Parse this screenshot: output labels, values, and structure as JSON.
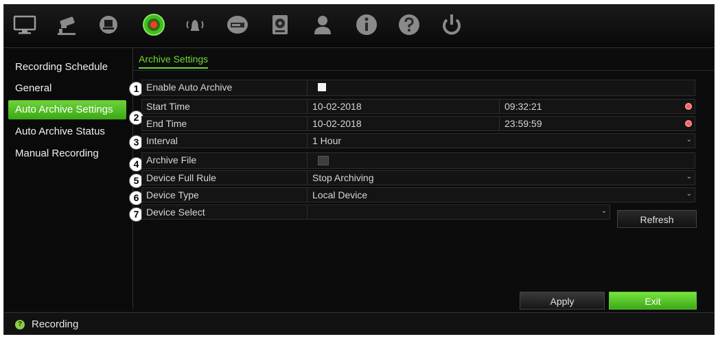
{
  "toolbar": {
    "icons": [
      "monitor-icon",
      "camera-icon",
      "network-icon",
      "record-icon",
      "alarm-icon",
      "hdd-icon",
      "storage-icon",
      "user-icon",
      "info-icon",
      "help-icon",
      "power-icon"
    ],
    "active_icon": "record-icon"
  },
  "sidebar": {
    "items": [
      {
        "label": "Recording Schedule"
      },
      {
        "label": "General"
      },
      {
        "label": "Auto Archive Settings"
      },
      {
        "label": "Auto Archive Status"
      },
      {
        "label": "Manual Recording"
      }
    ],
    "active_index": 2
  },
  "tab": {
    "label": "Archive Settings"
  },
  "form": {
    "enable_auto_archive": {
      "badge": "1",
      "label": "Enable Auto Archive",
      "checked": true
    },
    "time_badge": "2",
    "start_time": {
      "label": "Start Time",
      "date": "10-02-2018",
      "time": "09:32:21"
    },
    "end_time": {
      "label": "End Time",
      "date": "10-02-2018",
      "time": "23:59:59"
    },
    "interval": {
      "badge": "3",
      "label": "Interval",
      "value": "1 Hour"
    },
    "archive_file": {
      "badge": "4",
      "label": "Archive File"
    },
    "device_full_rule": {
      "badge": "5",
      "label": "Device Full Rule",
      "value": "Stop Archiving"
    },
    "device_type": {
      "badge": "6",
      "label": "Device Type",
      "value": "Local Device"
    },
    "device_select": {
      "badge": "7",
      "label": "Device Select",
      "value": ""
    }
  },
  "buttons": {
    "refresh": "Refresh",
    "apply": "Apply",
    "exit": "Exit"
  },
  "status": {
    "text": "Recording"
  },
  "colors": {
    "accent": "#5cc92a",
    "background": "#0c0c0c"
  }
}
